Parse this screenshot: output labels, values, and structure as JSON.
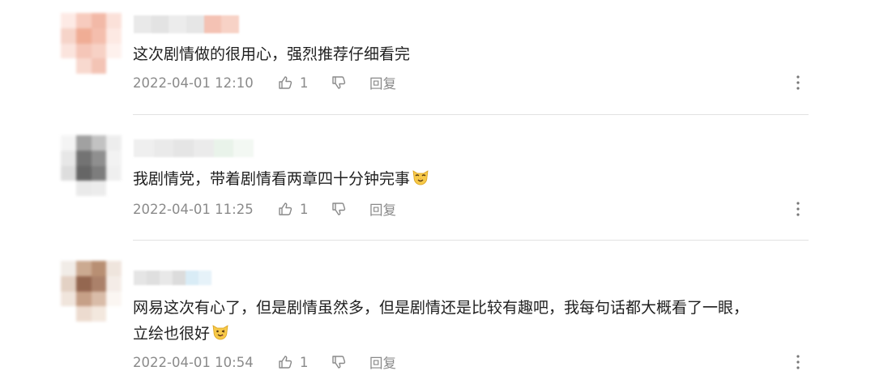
{
  "comments": [
    {
      "text": "这次剧情做的很用心，强烈推荐仔细看完",
      "time": "2022-04-01 12:10",
      "likes": "1",
      "reply_label": "回复",
      "avatar_colors": [
        "#fde9e4",
        "#f7c9bb",
        "#f2b6a3",
        "#fbe0d8",
        "#f6d2c7",
        "#f0a990",
        "#f4bba9",
        "#fde8e2",
        "#fbe3dc",
        "#f5c4b5",
        "#f7cfc2",
        "#fef1ed",
        "#ffffff",
        "#f8d7cd",
        "#f3c1b2",
        "#ffffff"
      ],
      "name_colors": [
        "#e9e9e9",
        "#e3e3e3",
        "#ececec",
        "#e6e6e6",
        "#f4c2b4",
        "#f7d2c6"
      ]
    },
    {
      "text": "我剧情党，带着剧情看两章四十分钟完事",
      "time": "2022-04-01 11:25",
      "likes": "1",
      "reply_label": "回复",
      "emoji": "cat-emoji",
      "avatar_colors": [
        "#f4f4f4",
        "#9c9c9c",
        "#bfbfbf",
        "#ededed",
        "#e6e6e6",
        "#6c6c6c",
        "#8a8a8a",
        "#f2f2f2",
        "#dcdcdc",
        "#5e5e5e",
        "#777777",
        "#efefef",
        "#ffffff",
        "#e9e9e9",
        "#ececec",
        "#ffffff"
      ],
      "name_colors": [
        "#efefef",
        "#eaeaea",
        "#e5e5e5",
        "#ebebeb",
        "#e9f3ea",
        "#f3f8f3"
      ]
    },
    {
      "text_line1": "网易这次有心了，但是剧情虽然多，但是剧情还是比较有趣吧，我每句话都大概看了一眼，",
      "text_line2": "立绘也很好",
      "time": "2022-04-01 10:54",
      "likes": "1",
      "reply_label": "回复",
      "emoji": "wink-emoji",
      "avatar_colors": [
        "#f1ebe6",
        "#c9a68c",
        "#b58a6c",
        "#efe4dc",
        "#e2cfc1",
        "#8f5f47",
        "#a77b63",
        "#f4ece6",
        "#f0e4db",
        "#c49b81",
        "#d8b9a4",
        "#fbf6f2",
        "#ffffff",
        "#ecdacd",
        "#f3e7dd",
        "#ffffff"
      ],
      "name_colors": [
        "#e5e5e5",
        "#dfdfdf",
        "#e8e8e8",
        "#dcdcdc",
        "#d9ecf6",
        "#e6f2f9"
      ]
    }
  ],
  "colors": {
    "meta_text": "#8a8a8a",
    "divider": "#e2e2e2",
    "body_text": "#1f1f1f"
  },
  "icons": {
    "like": "thumb-up-icon",
    "dislike": "thumb-down-icon",
    "more": "more-vertical-icon"
  }
}
